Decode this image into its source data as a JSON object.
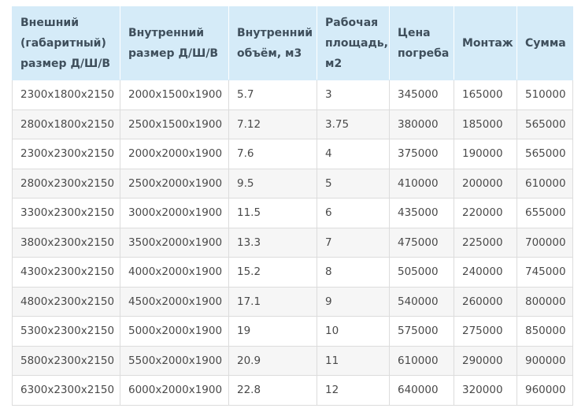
{
  "table": {
    "headers": [
      "Внешний (габаритный) размер Д/Ш/В",
      "Внутренний размер Д/Ш/В",
      "Внутренний объём, м3",
      "Рабочая площадь, м2",
      "Цена погреба",
      "Монтаж",
      "Сумма"
    ],
    "rows": [
      [
        "2300х1800х2150",
        "2000х1500х1900",
        "5.7",
        "3",
        "345000",
        "165000",
        "510000"
      ],
      [
        "2800х1800х2150",
        "2500х1500х1900",
        "7.12",
        "3.75",
        "380000",
        "185000",
        "565000"
      ],
      [
        "2300х2300х2150",
        "2000х2000х1900",
        "7.6",
        "4",
        "375000",
        "190000",
        "565000"
      ],
      [
        "2800х2300х2150",
        "2500х2000х1900",
        "9.5",
        "5",
        "410000",
        "200000",
        "610000"
      ],
      [
        "3300х2300х2150",
        "3000х2000х1900",
        "11.5",
        "6",
        "435000",
        "220000",
        "655000"
      ],
      [
        "3800х2300х2150",
        "3500х2000х1900",
        "13.3",
        "7",
        "475000",
        "225000",
        "700000"
      ],
      [
        "4300х2300х2150",
        "4000х2000х1900",
        "15.2",
        "8",
        "505000",
        "240000",
        "745000"
      ],
      [
        "4800х2300х2150",
        "4500х2000х1900",
        "17.1",
        "9",
        "540000",
        "260000",
        "800000"
      ],
      [
        "5300х2300х2150",
        "5000х2000х1900",
        "19",
        "10",
        "575000",
        "275000",
        "850000"
      ],
      [
        "5800х2300х2150",
        "5500х2000х1900",
        "20.9",
        "11",
        "610000",
        "290000",
        "900000"
      ],
      [
        "6300х2300х2150",
        "6000х2000х1900",
        "22.8",
        "12",
        "640000",
        "320000",
        "960000"
      ]
    ]
  }
}
